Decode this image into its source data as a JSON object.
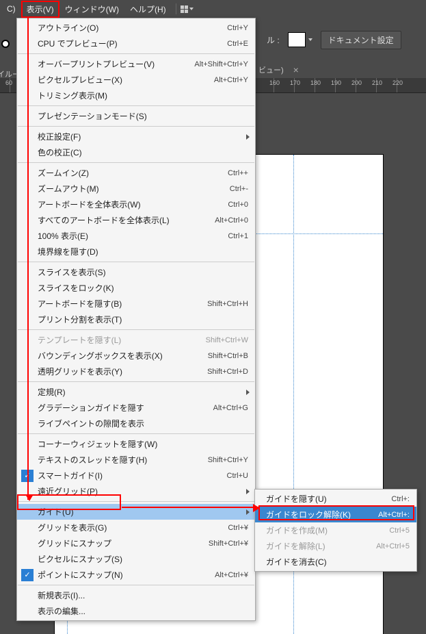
{
  "menubar": {
    "items": [
      {
        "label": "C)"
      },
      {
        "label": "表示(V)",
        "active": true
      },
      {
        "label": "ウィンドウ(W)"
      },
      {
        "label": "ヘルプ(H)"
      }
    ]
  },
  "toolbar": {
    "fill_label": "ル :",
    "doc_settings": "ドキュメント設定"
  },
  "tab": {
    "label": "ビュー)",
    "close": "×"
  },
  "left_fragment": "イルー",
  "ruler": {
    "ticks": [
      60,
      160,
      170,
      180,
      190,
      200,
      210,
      220
    ]
  },
  "menu": {
    "groups": [
      [
        {
          "label": "アウトライン(O)",
          "shortcut": "Ctrl+Y"
        },
        {
          "label": "CPU でプレビュー(P)",
          "shortcut": "Ctrl+E"
        }
      ],
      [
        {
          "label": "オーバープリントプレビュー(V)",
          "shortcut": "Alt+Shift+Ctrl+Y"
        },
        {
          "label": "ピクセルプレビュー(X)",
          "shortcut": "Alt+Ctrl+Y"
        },
        {
          "label": "トリミング表示(M)"
        }
      ],
      [
        {
          "label": "プレゼンテーションモード(S)"
        }
      ],
      [
        {
          "label": "校正設定(F)",
          "submenu": true
        },
        {
          "label": "色の校正(C)"
        }
      ],
      [
        {
          "label": "ズームイン(Z)",
          "shortcut": "Ctrl++"
        },
        {
          "label": "ズームアウト(M)",
          "shortcut": "Ctrl+-"
        },
        {
          "label": "アートボードを全体表示(W)",
          "shortcut": "Ctrl+0"
        },
        {
          "label": "すべてのアートボードを全体表示(L)",
          "shortcut": "Alt+Ctrl+0"
        },
        {
          "label": "100% 表示(E)",
          "shortcut": "Ctrl+1"
        },
        {
          "label": "境界線を隠す(D)"
        }
      ],
      [
        {
          "label": "スライスを表示(S)"
        },
        {
          "label": "スライスをロック(K)"
        },
        {
          "label": "アートボードを隠す(B)",
          "shortcut": "Shift+Ctrl+H"
        },
        {
          "label": "プリント分割を表示(T)"
        }
      ],
      [
        {
          "label": "テンプレートを隠す(L)",
          "shortcut": "Shift+Ctrl+W",
          "disabled": true
        },
        {
          "label": "バウンディングボックスを表示(X)",
          "shortcut": "Shift+Ctrl+B"
        },
        {
          "label": "透明グリッドを表示(Y)",
          "shortcut": "Shift+Ctrl+D"
        }
      ],
      [
        {
          "label": "定規(R)",
          "submenu": true
        },
        {
          "label": "グラデーションガイドを隠す",
          "shortcut": "Alt+Ctrl+G"
        },
        {
          "label": "ライブペイントの隙間を表示"
        }
      ],
      [
        {
          "label": "コーナーウィジェットを隠す(W)"
        },
        {
          "label": "テキストのスレッドを隠す(H)",
          "shortcut": "Shift+Ctrl+Y"
        },
        {
          "label": "スマートガイド(I)",
          "shortcut": "Ctrl+U",
          "checked": true
        },
        {
          "label": "遠近グリッド(P)",
          "submenu": true
        }
      ],
      [
        {
          "label": "ガイド(U)",
          "submenu": true,
          "highlight": true
        },
        {
          "label": "グリッドを表示(G)",
          "shortcut": "Ctrl+¥"
        },
        {
          "label": "グリッドにスナップ",
          "shortcut": "Shift+Ctrl+¥"
        },
        {
          "label": "ピクセルにスナップ(S)"
        },
        {
          "label": "ポイントにスナップ(N)",
          "shortcut": "Alt+Ctrl+¥",
          "checked": true
        }
      ],
      [
        {
          "label": "新規表示(I)..."
        },
        {
          "label": "表示の編集..."
        }
      ]
    ]
  },
  "submenu": {
    "items": [
      {
        "label": "ガイドを隠す(U)",
        "shortcut": "Ctrl+:"
      },
      {
        "label": "ガイドをロック解除(K)",
        "shortcut": "Alt+Ctrl+:",
        "selected": true
      },
      {
        "label": "ガイドを作成(M)",
        "shortcut": "Ctrl+5",
        "disabled": true
      },
      {
        "label": "ガイドを解除(L)",
        "shortcut": "Alt+Ctrl+5",
        "disabled": true
      },
      {
        "label": "ガイドを消去(C)"
      }
    ]
  }
}
